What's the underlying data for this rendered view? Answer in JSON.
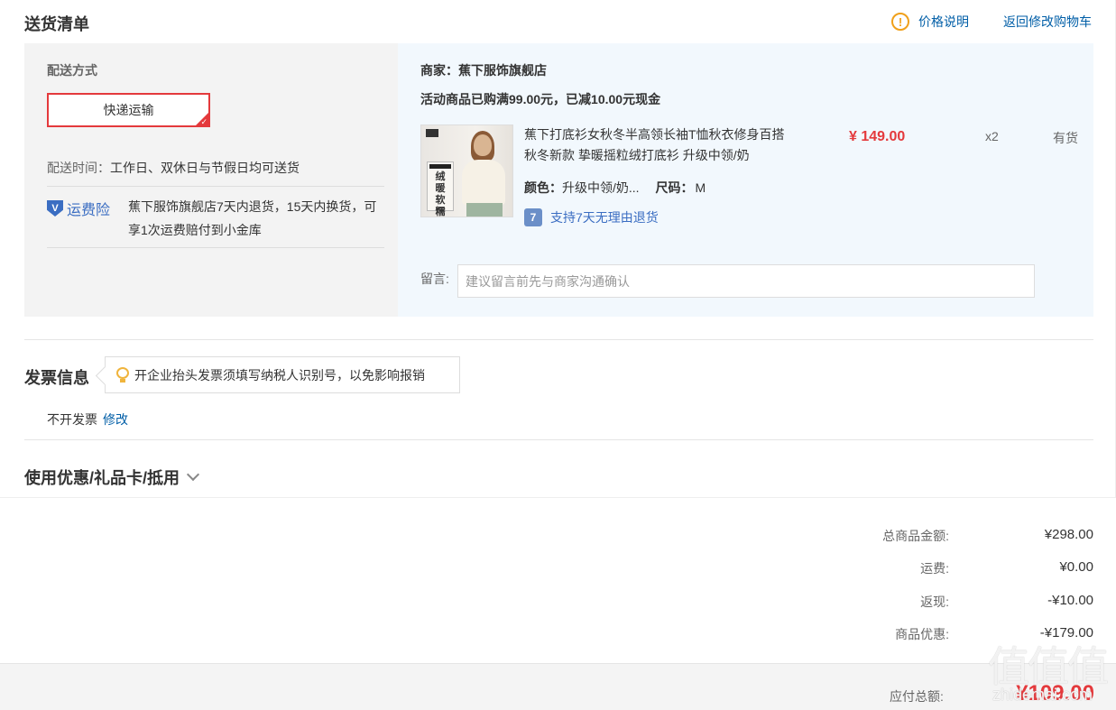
{
  "delivery": {
    "title": "送货清单",
    "price_note": "价格说明",
    "back_to_cart": "返回修改购物车",
    "method_label": "配送方式",
    "method_value": "快递运输",
    "time_label": "配送时间：",
    "time_value": "工作日、双休日与节假日均可送货",
    "insurance_label": "运费险",
    "insurance_text": "蕉下服饰旗舰店7天内退货，15天内换货，可享1次运费赔付到小金库"
  },
  "order": {
    "shop": "商家：蕉下服饰旗舰店",
    "promo": "活动商品已购满99.00元，已减10.00元现金",
    "product": {
      "title": "蕉下打底衫女秋冬半高领长袖T恤秋衣修身百搭 秋冬新款 挚暖摇粒绒打底衫 升级中领/奶",
      "thumb_text": "绒暖软糯",
      "color_label": "颜色：",
      "color_value": "升级中领/奶...",
      "size_label": "尺码：",
      "size_value": "M",
      "price": "¥ 149.00",
      "qty": "x2",
      "stock": "有货",
      "return_policy": "支持7天无理由退货"
    },
    "message_label": "留言:",
    "message_placeholder": "建议留言前先与商家沟通确认"
  },
  "invoice": {
    "title": "发票信息",
    "tip": "开企业抬头发票须填写纳税人识别号，以免影响报销",
    "value": "不开发票",
    "edit": "修改"
  },
  "coupon": {
    "title": "使用优惠/礼品卡/抵用"
  },
  "summary": {
    "rows": [
      {
        "label": "总商品金额:",
        "value": "¥298.00"
      },
      {
        "label": "运费:",
        "value": "¥0.00"
      },
      {
        "label": "返现:",
        "value": "-¥10.00"
      },
      {
        "label": "商品优惠:",
        "value": "-¥179.00"
      }
    ],
    "total_label": "应付总额:",
    "total_value": "¥109.00"
  },
  "watermark": {
    "text": "值值值",
    "sub": "zhidemai.com"
  },
  "colors": {
    "accent_red": "#e4393c",
    "link_blue": "#005ea7",
    "insurance_blue": "#3a6dc2",
    "warn_orange": "#f0a01a"
  }
}
